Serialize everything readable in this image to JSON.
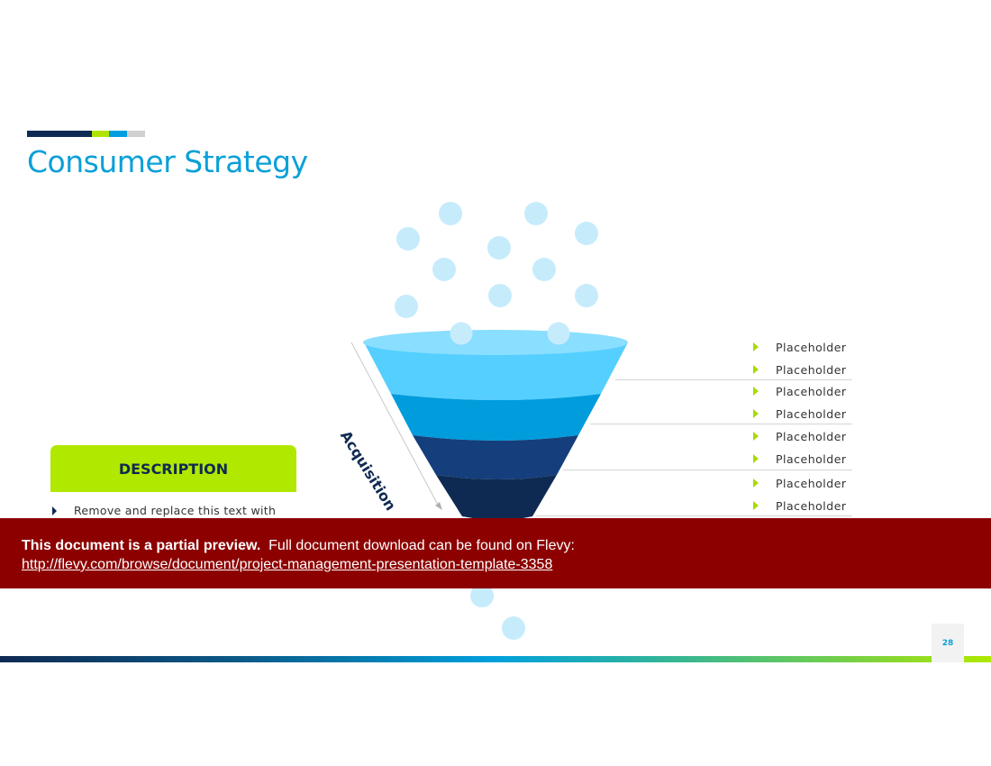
{
  "slide": {
    "title": "Consumer Strategy",
    "accent_colors": [
      "#0f2a52",
      "#b0e400",
      "#009ee0",
      "#d0d0d0"
    ],
    "page_number": "28"
  },
  "funnel": {
    "axis_label": "Acquisition",
    "layer_colors": [
      "#55cfff",
      "#009cdc",
      "#143e7c",
      "#0f2a52"
    ],
    "rim_color": "#8adeff",
    "bubble_color": "#c6ecfc",
    "bubble_icon": "circle-icon"
  },
  "placeholders": {
    "icon": "triangle-right-icon",
    "groups": [
      [
        "Placeholder",
        "Placeholder"
      ],
      [
        "Placeholder",
        "Placeholder"
      ],
      [
        "Placeholder",
        "Placeholder"
      ],
      [
        "Placeholder",
        "Placeholder"
      ]
    ]
  },
  "description": {
    "heading": "DESCRIPTION",
    "bullets": [
      "Remove and replace this text with"
    ],
    "box_color": "#b0e800"
  },
  "preview_banner": {
    "bold_text": "This document is a partial preview.",
    "text": "Full document download can be found on Flevy:",
    "link": "http://flevy.com/browse/document/project-management-presentation-template-3358",
    "background": "#8c0000"
  }
}
